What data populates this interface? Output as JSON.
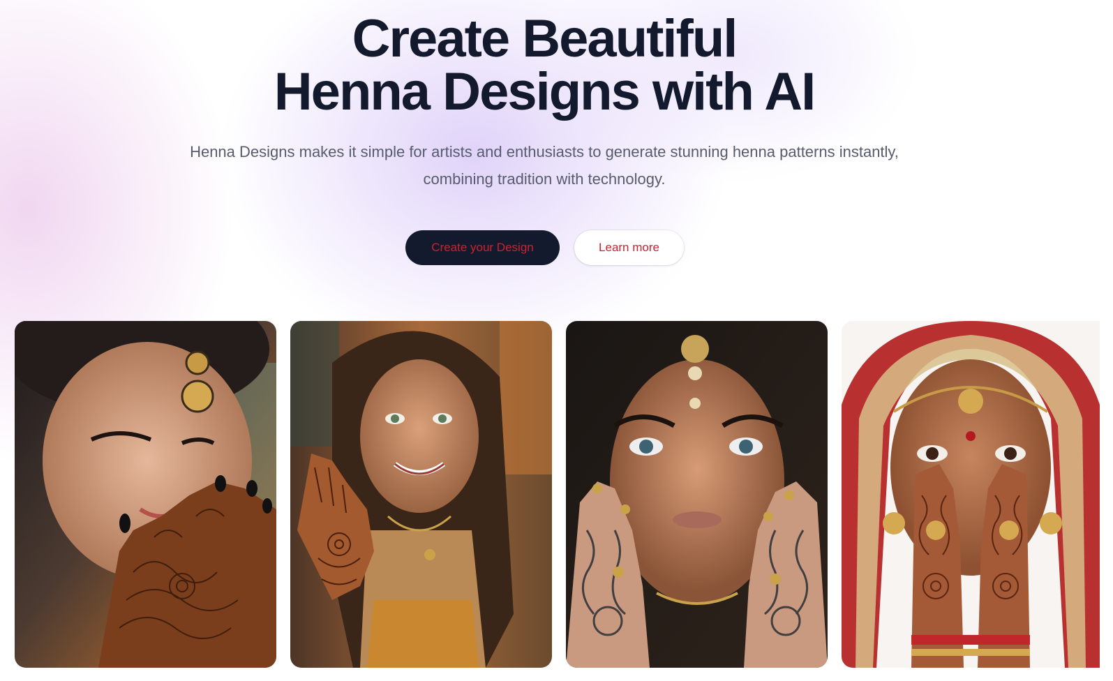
{
  "hero": {
    "headline_line1": "Create Beautiful",
    "headline_line2": "Henna Designs with AI",
    "subtitle_line1": "Henna Designs makes it simple for artists and enthusiasts to generate stunning henna patterns instantly,",
    "subtitle_line2": "combining tradition with technology."
  },
  "buttons": {
    "primary_label": "Create your Design",
    "secondary_label": "Learn more"
  },
  "colors": {
    "headline": "#141a2e",
    "subtitle": "#565c6e",
    "primary_bg": "#141a2e",
    "button_text": "#d21f2b",
    "secondary_bg": "#ffffff"
  },
  "gallery": {
    "images": [
      {
        "subject": "woman-with-henna-hand-looking-down"
      },
      {
        "subject": "smiling-girl-raising-henna-hand"
      },
      {
        "subject": "woman-with-tattooed-hands-near-face"
      },
      {
        "subject": "bride-covering-face-with-henna-hands"
      }
    ]
  }
}
